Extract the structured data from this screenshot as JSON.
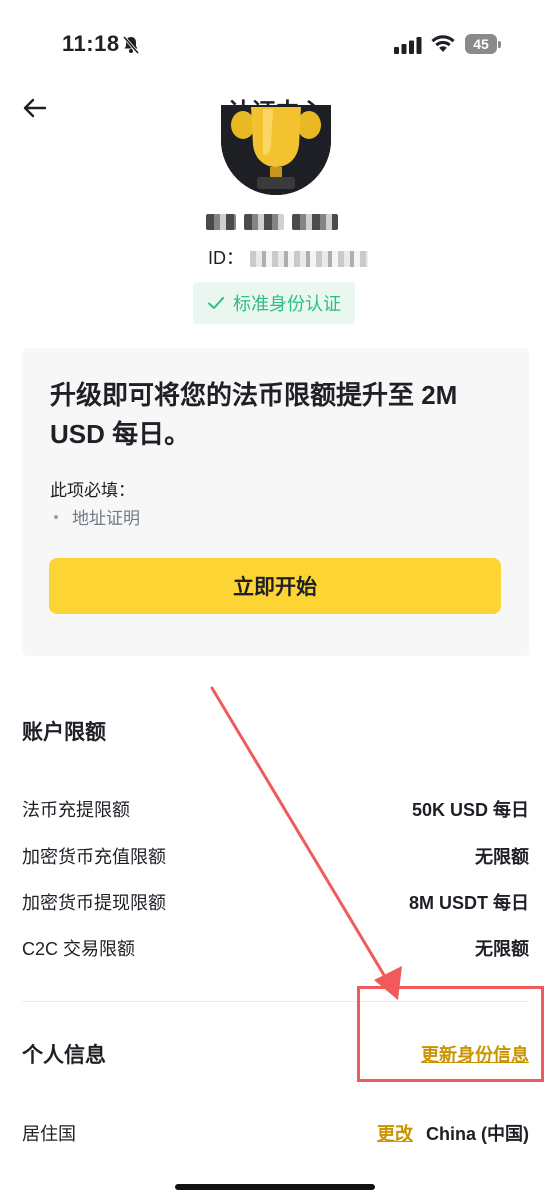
{
  "status_bar": {
    "time": "11:18",
    "battery": "45"
  },
  "nav": {
    "title": "认证中心"
  },
  "profile": {
    "id_label": "ID："
  },
  "kyc": {
    "badge": "标准身份认证"
  },
  "upgrade": {
    "title": "升级即可将您的法币限额提升至 2M USD 每日。",
    "required_label": "此项必填：",
    "required_items": [
      "地址证明"
    ],
    "start_button": "立即开始"
  },
  "limits": {
    "title": "账户限额",
    "rows": [
      {
        "label": "法币充提限额",
        "value": "50K USD 每日"
      },
      {
        "label": "加密货币充值限额",
        "value": "无限额"
      },
      {
        "label": "加密货币提现限额",
        "value": "8M USDT 每日"
      },
      {
        "label": "C2C 交易限额",
        "value": "无限额"
      }
    ]
  },
  "personal": {
    "title": "个人信息",
    "update_link": "更新身份信息",
    "residence_label": "居住国",
    "change_link": "更改",
    "residence_value": "China (中国)"
  },
  "colors": {
    "accent": "#fcd535",
    "link": "#c99400",
    "success": "#2ebd85",
    "annotation": "#f05a5a"
  }
}
